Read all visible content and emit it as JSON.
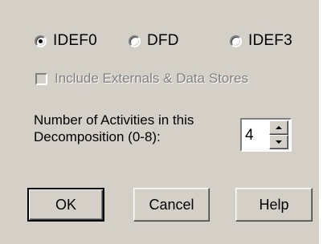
{
  "dialog": {
    "radios": [
      {
        "label": "IDEF0",
        "selected": true
      },
      {
        "label": "DFD",
        "selected": false
      },
      {
        "label": "IDEF3",
        "selected": false
      }
    ],
    "include_checkbox": {
      "label": "Include Externals & Data Stores",
      "checked": false,
      "enabled": false
    },
    "activities": {
      "label_line1": "Number of Activities in this",
      "label_line2": "Decomposition (0-8):",
      "value": "4"
    },
    "buttons": {
      "ok": "OK",
      "cancel": "Cancel",
      "help": "Help"
    }
  },
  "colors": {
    "face": "#d4d0c8",
    "disabled_text": "#808080"
  }
}
